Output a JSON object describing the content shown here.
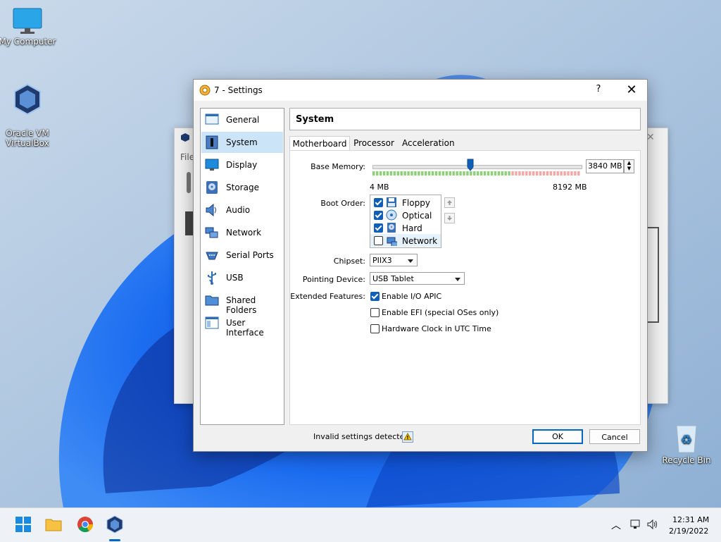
{
  "desktop": {
    "icons": [
      {
        "label": "My Computer"
      },
      {
        "label": "Oracle VM\nVirtualBox"
      },
      {
        "label": "Recycle Bin"
      }
    ],
    "back_window": {
      "menu_label": "File"
    }
  },
  "dialog": {
    "title": "7 - Settings",
    "help": "?",
    "close": "✕",
    "section_title": "System",
    "nav": [
      {
        "label": "General",
        "icon": "general-icon"
      },
      {
        "label": "System",
        "icon": "system-icon",
        "selected": true
      },
      {
        "label": "Display",
        "icon": "display-icon"
      },
      {
        "label": "Storage",
        "icon": "storage-icon"
      },
      {
        "label": "Audio",
        "icon": "audio-icon"
      },
      {
        "label": "Network",
        "icon": "network-icon"
      },
      {
        "label": "Serial Ports",
        "icon": "serial-ports-icon"
      },
      {
        "label": "USB",
        "icon": "usb-icon"
      },
      {
        "label": "Shared Folders",
        "icon": "shared-folders-icon"
      },
      {
        "label": "User Interface",
        "icon": "user-interface-icon"
      }
    ],
    "tabs": [
      {
        "label": "Motherboard",
        "active": true
      },
      {
        "label": "Processor"
      },
      {
        "label": "Acceleration"
      }
    ],
    "motherboard": {
      "base_memory_label": "Base Memory:",
      "base_memory_value": "3840 MB",
      "memory_min": "4 MB",
      "memory_max": "8192 MB",
      "memory_fraction": 0.468,
      "boot_order_label": "Boot Order:",
      "boot_order": [
        {
          "label": "Floppy",
          "checked": true,
          "icon": "floppy-icon"
        },
        {
          "label": "Optical",
          "checked": true,
          "icon": "optical-icon"
        },
        {
          "label": "Hard Disk",
          "checked": true,
          "icon": "hard-disk-icon"
        },
        {
          "label": "Network",
          "checked": false,
          "icon": "network-icon"
        }
      ],
      "chipset_label": "Chipset:",
      "chipset_value": "PIIX3",
      "pointing_label": "Pointing Device:",
      "pointing_value": "USB Tablet",
      "extended_label": "Extended Features:",
      "features": [
        {
          "label": "Enable I/O APIC",
          "checked": true
        },
        {
          "label": "Enable EFI (special OSes only)",
          "checked": false
        },
        {
          "label": "Hardware Clock in UTC Time",
          "checked": false
        }
      ]
    },
    "status": "Invalid settings detected",
    "ok": "OK",
    "cancel": "Cancel"
  },
  "taskbar": {
    "time": "12:31 AM",
    "date": "2/19/2022"
  },
  "colors": {
    "accent": "#0067c0",
    "selection": "#cce4f7",
    "mem_green": "#8ed07a",
    "mem_red": "#f3a7a7"
  }
}
